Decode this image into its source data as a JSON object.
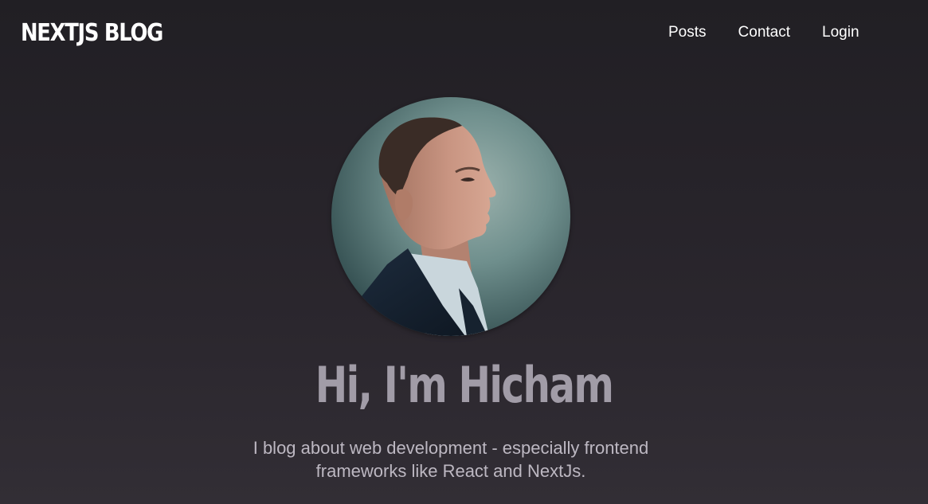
{
  "header": {
    "brand": "NEXTJS BLOG",
    "nav": [
      {
        "label": "Posts"
      },
      {
        "label": "Contact"
      },
      {
        "label": "Login"
      }
    ]
  },
  "hero": {
    "avatar_alt": "Profile photo of Hicham",
    "title": "Hi, I'm Hicham",
    "subtitle": "I blog about web development - especially frontend frameworks like React and NextJs."
  },
  "colors": {
    "background": "#27242a",
    "title": "#a19ca7",
    "subtitle": "#bdb8c2",
    "nav_text": "#ffffff"
  }
}
